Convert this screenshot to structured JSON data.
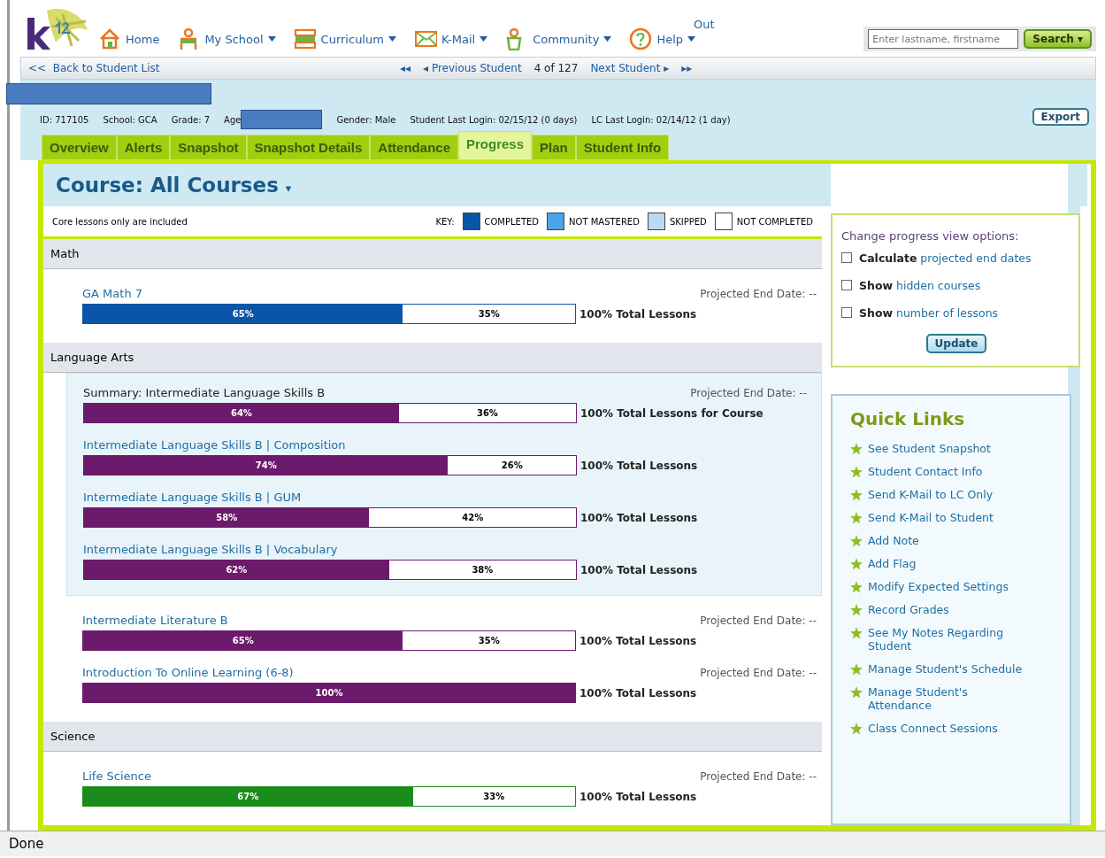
{
  "header": {
    "nav": [
      {
        "label": "Home",
        "dropdown": false
      },
      {
        "label": "My School",
        "dropdown": true
      },
      {
        "label": "Curriculum",
        "dropdown": true
      },
      {
        "label": "K-Mail",
        "dropdown": true
      },
      {
        "label": "Community",
        "dropdown": true
      },
      {
        "label": "Help",
        "dropdown": true
      }
    ],
    "out_label": "Out",
    "search": {
      "placeholder": "Enter lastname, firstname",
      "button": "Search ▾"
    }
  },
  "student_nav": {
    "back": "<<  Back to Student List",
    "first": "◂◂",
    "previous": "◂ Previous Student",
    "position": "4 of 127",
    "next": "Next Student ▸",
    "last": "▸▸"
  },
  "student_info": [
    {
      "text": "ID: 717105"
    },
    {
      "text": "School: GCA"
    },
    {
      "text": "Grade: 7"
    },
    {
      "text": "Age",
      "redacted_after": true
    },
    {
      "text": "Gender: Male"
    },
    {
      "text": "Student Last Login: 02/15/12 (0 days)"
    },
    {
      "text": "LC Last Login: 02/14/12 (1 day)"
    }
  ],
  "export_button": "Export",
  "tabs": [
    {
      "label": "Overview",
      "selected": false
    },
    {
      "label": "Alerts",
      "selected": false
    },
    {
      "label": "Snapshot",
      "selected": false
    },
    {
      "label": "Snapshot Details",
      "selected": false
    },
    {
      "label": "Attendance",
      "selected": false
    },
    {
      "label": "Progress",
      "selected": true
    },
    {
      "label": "Plan",
      "selected": false
    },
    {
      "label": "Student Info",
      "selected": false
    }
  ],
  "course_title": "Course: All Courses",
  "course_caret": "▾",
  "note": "Core lessons only are included",
  "key": {
    "label": "KEY:",
    "items": [
      {
        "label": "COMPLETED",
        "color": "#0a55a8"
      },
      {
        "label": "NOT MASTERED",
        "color": "#4ba3ea"
      },
      {
        "label": "SKIPPED",
        "color": "#b9d9f5"
      },
      {
        "label": "NOT COMPLETED",
        "color": "#ffffff"
      }
    ]
  },
  "sections": [
    {
      "name": "Math",
      "color": "#0a55a8",
      "courses": [
        {
          "kind": "course",
          "name": "GA Math 7",
          "projected": "Projected End Date: --",
          "level": 0.65,
          "completed": "65%",
          "remaining": "35%",
          "total": "100% Total Lessons"
        }
      ]
    },
    {
      "name": "Language Arts",
      "color": "#6c1a6c",
      "courses": [
        {
          "kind": "group",
          "children": [
            {
              "kind": "summary",
              "name": "Summary: Intermediate Language Skills B",
              "projected": "Projected End Date: --",
              "level": 0.64,
              "completed": "64%",
              "remaining": "36%",
              "total": "100% Total Lessons for Course"
            },
            {
              "kind": "course",
              "name": "Intermediate Language Skills B | Composition",
              "level": 0.74,
              "completed": "74%",
              "remaining": "26%",
              "total": "100% Total Lessons"
            },
            {
              "kind": "course",
              "name": "Intermediate Language Skills B | GUM",
              "level": 0.58,
              "completed": "58%",
              "remaining": "42%",
              "total": "100% Total Lessons"
            },
            {
              "kind": "course",
              "name": "Intermediate Language Skills B | Vocabulary",
              "level": 0.62,
              "completed": "62%",
              "remaining": "38%",
              "total": "100% Total Lessons"
            }
          ]
        },
        {
          "kind": "course",
          "name": "Intermediate Literature B",
          "projected": "Projected End Date: --",
          "level": 0.65,
          "completed": "65%",
          "remaining": "35%",
          "total": "100% Total Lessons"
        },
        {
          "kind": "course",
          "name": "Introduction To Online Learning (6-8)",
          "projected": "Projected End Date: --",
          "level": 1,
          "completed": "100%",
          "total": "100% Total Lessons"
        }
      ]
    },
    {
      "name": "Science",
      "color": "#1b8c1b",
      "courses": [
        {
          "kind": "course",
          "name": "Life Science",
          "projected": "Projected End Date: --",
          "level": 0.67,
          "completed": "67%",
          "remaining": "33%",
          "total": "100% Total Lessons"
        }
      ]
    }
  ],
  "options": {
    "title": "Change progress view options:",
    "items": [
      {
        "label": "**Calculate** projected end dates",
        "checked": false
      },
      {
        "label": "**Show** hidden courses",
        "checked": false
      },
      {
        "label": "**Show** number of lessons",
        "checked": false
      }
    ],
    "button": "Update"
  },
  "quick_links": {
    "title": "Quick Links",
    "items": [
      "See Student Snapshot",
      "Student Contact Info",
      "Send K-Mail to LC Only",
      "Send K-Mail to Student",
      "Add Note",
      "Add Flag",
      "Modify Expected Settings",
      "Record Grades",
      "See My Notes Regarding Student",
      "Manage Student's Schedule",
      "Manage Student's Attendance",
      "Class Connect Sessions"
    ]
  },
  "status_bar": "Done"
}
